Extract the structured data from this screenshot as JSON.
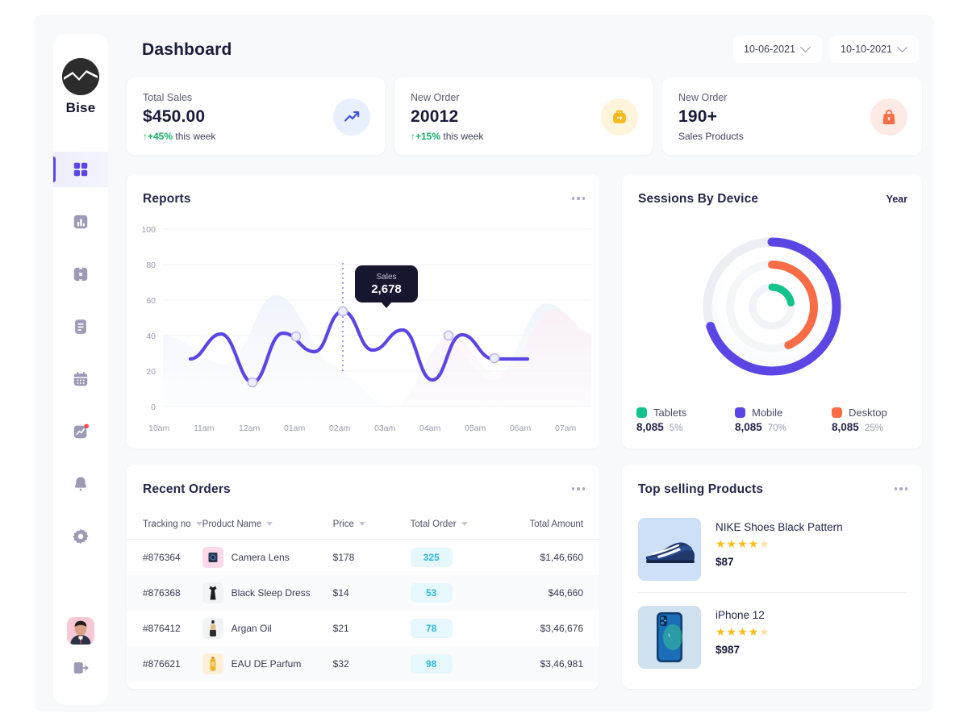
{
  "app": {
    "brand_name": "Bise",
    "page_title": "Dashboard"
  },
  "sidebar": {
    "items": [
      {
        "icon": "grid-icon",
        "name": "dashboard",
        "active": true
      },
      {
        "icon": "bar-chart-icon",
        "name": "analytics",
        "active": false
      },
      {
        "icon": "puzzle-icon",
        "name": "components",
        "active": false
      },
      {
        "icon": "document-icon",
        "name": "documents",
        "active": false
      },
      {
        "icon": "calendar-icon",
        "name": "calendar",
        "active": false
      },
      {
        "icon": "trend-icon",
        "name": "reports",
        "active": false
      },
      {
        "icon": "bell-icon",
        "name": "notifications",
        "active": false
      },
      {
        "icon": "gear-icon",
        "name": "settings",
        "active": false
      }
    ],
    "avatar_name": "user-avatar",
    "logout_name": "logout-icon"
  },
  "header": {
    "date_from": "10-06-2021",
    "date_to": "10-10-2021"
  },
  "stats": [
    {
      "label": "Total Sales",
      "value": "$450.00",
      "delta": "↑+45%",
      "delta_suffix": " this week",
      "icon": "trending-up-icon",
      "icon_bg": "#e8f0fd",
      "accent": "#17b26a"
    },
    {
      "label": "New Order",
      "value": "20012",
      "delta": "↑+15%",
      "delta_suffix": " this week",
      "icon": "gift-box-icon",
      "icon_bg": "#fdf4dc",
      "accent": "#17b26a"
    },
    {
      "label": "New Order",
      "value": "190+",
      "delta": "",
      "delta_suffix": "Sales Products",
      "icon": "shopping-bag-icon",
      "icon_bg": "#fdeae4",
      "accent": "#3f3f5a"
    }
  ],
  "reports": {
    "title": "Reports",
    "menu": "more-options",
    "tooltip_label": "Sales",
    "tooltip_value": "2,678"
  },
  "sessions": {
    "title": "Sessions By Device",
    "period": "Year",
    "legend": [
      {
        "name": "Tablets",
        "value": "8,085",
        "percent": "5%",
        "color": "#12c48b"
      },
      {
        "name": "Mobile",
        "value": "8,085",
        "percent": "70%",
        "color": "#5a46e5"
      },
      {
        "name": "Desktop",
        "value": "8,085",
        "percent": "25%",
        "color": "#f96c45"
      }
    ]
  },
  "orders": {
    "title": "Recent Orders",
    "menu": "more-options",
    "columns": [
      {
        "label": "Tracking no",
        "sortable": true
      },
      {
        "label": "Product Name",
        "sortable": true
      },
      {
        "label": "Price",
        "sortable": true
      },
      {
        "label": "Total Order",
        "sortable": true
      },
      {
        "label": "Total Amount",
        "sortable": false
      }
    ],
    "rows": [
      {
        "tracking": "#876364",
        "product": "Camera Lens",
        "price": "$178",
        "total_order": "325",
        "total_amount": "$1,46,660",
        "thumb": "camera-lens-thumb",
        "thumb_bg": "#fbd9e8"
      },
      {
        "tracking": "#876368",
        "product": "Black Sleep Dress",
        "price": "$14",
        "total_order": "53",
        "total_amount": "$46,660",
        "thumb": "black-dress-thumb",
        "thumb_bg": "#f2f3f5"
      },
      {
        "tracking": "#876412",
        "product": "Argan Oil",
        "price": "$21",
        "total_order": "78",
        "total_amount": "$3,46,676",
        "thumb": "argan-oil-thumb",
        "thumb_bg": "#f2f3f5"
      },
      {
        "tracking": "#876621",
        "product": "EAU DE Parfum",
        "price": "$32",
        "total_order": "98",
        "total_amount": "$3,46,981",
        "thumb": "perfume-thumb",
        "thumb_bg": "#fdf0d8"
      }
    ]
  },
  "top_selling": {
    "title": "Top selling Products",
    "menu": "more-options",
    "items": [
      {
        "name": "NIKE Shoes Black Pattern",
        "price": "$87",
        "rating": 4,
        "max_rating": 5,
        "thumb": "nike-shoe-thumb",
        "thumb_bg": "#cde0f8"
      },
      {
        "name": "iPhone 12",
        "price": "$987",
        "rating": 4,
        "max_rating": 5,
        "thumb": "iphone-12-thumb",
        "thumb_bg": "#cfe0ef"
      }
    ]
  },
  "chart_data": {
    "type": "line",
    "title": "Reports",
    "xlabel": "",
    "ylabel": "",
    "ylim": [
      0,
      100
    ],
    "yticks": [
      0,
      20,
      40,
      60,
      80,
      100
    ],
    "grid": true,
    "legend_position": "none",
    "categories": [
      "10am",
      "11am",
      "12am",
      "01am",
      "02am",
      "03am",
      "04am",
      "05am",
      "06am",
      "07am"
    ],
    "series": [
      {
        "name": "Sales",
        "color": "#5a46e5",
        "values": [
          27,
          41,
          14,
          42,
          31,
          51,
          32,
          44,
          37,
          27
        ]
      }
    ],
    "markers": [
      {
        "x": "12am",
        "y": 14
      },
      {
        "x": "01am",
        "y": 42
      },
      {
        "x": "03am",
        "y": 51
      },
      {
        "x": "05am",
        "y": 44
      },
      {
        "x": "06am",
        "y": 37
      }
    ],
    "annotation": {
      "label": "Sales",
      "value": "2,678",
      "at_x": "03am"
    }
  },
  "donut_data": {
    "type": "pie",
    "title": "Sessions By Device",
    "rings": [
      {
        "name": "Mobile",
        "percent": 70,
        "value": "8,085",
        "color": "#5a46e5",
        "track": "#eceef4"
      },
      {
        "name": "Desktop",
        "percent": 25,
        "value": "8,085",
        "color": "#f96c45",
        "track": "#f4f5f9"
      },
      {
        "name": "Tablets",
        "percent": 5,
        "value": "8,085",
        "color": "#12c48b",
        "track": "#f4f5f9"
      }
    ]
  }
}
